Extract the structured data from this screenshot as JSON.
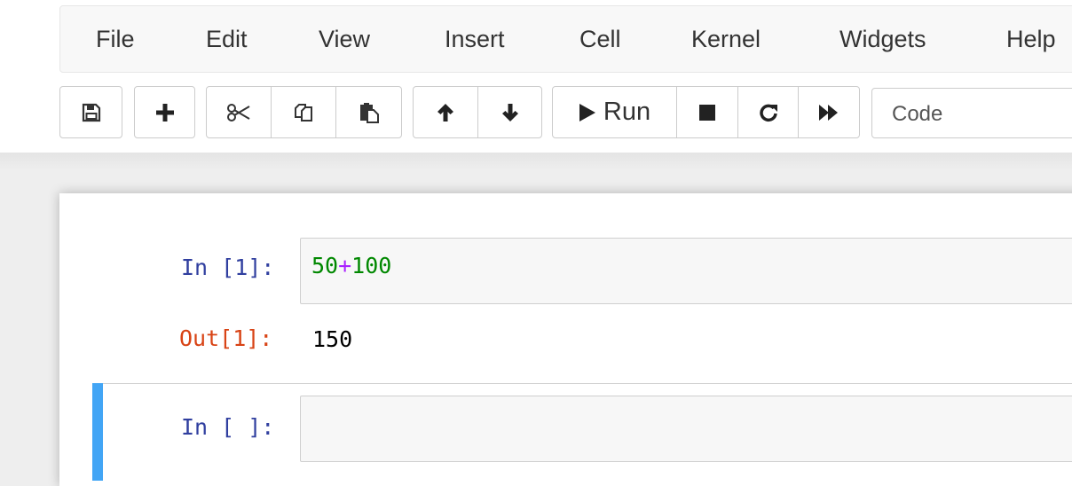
{
  "menubar": {
    "items": [
      {
        "label": "File"
      },
      {
        "label": "Edit"
      },
      {
        "label": "View"
      },
      {
        "label": "Insert"
      },
      {
        "label": "Cell"
      },
      {
        "label": "Kernel"
      },
      {
        "label": "Widgets"
      },
      {
        "label": "Help"
      }
    ]
  },
  "toolbar": {
    "run_label": "Run",
    "cell_type_selected": "Code",
    "icons": [
      "save-icon",
      "plus-icon",
      "scissors-icon",
      "copy-icon",
      "paste-icon",
      "arrow-up-icon",
      "arrow-down-icon",
      "play-icon",
      "stop-icon",
      "restart-icon",
      "fast-forward-icon"
    ]
  },
  "cells": [
    {
      "in_prompt": "In [1]:",
      "code_tokens": [
        {
          "text": "50",
          "type": "number"
        },
        {
          "text": "+",
          "type": "operator"
        },
        {
          "text": "100",
          "type": "number"
        }
      ],
      "out_prompt": "Out[1]:",
      "output": "150"
    },
    {
      "in_prompt": "In [ ]:",
      "code": ""
    }
  ],
  "colors": {
    "in_prompt": "#303f9f",
    "out_prompt": "#d84315",
    "number": "#008800",
    "operator": "#aa22ff",
    "selected_bar": "#42a5f5"
  }
}
